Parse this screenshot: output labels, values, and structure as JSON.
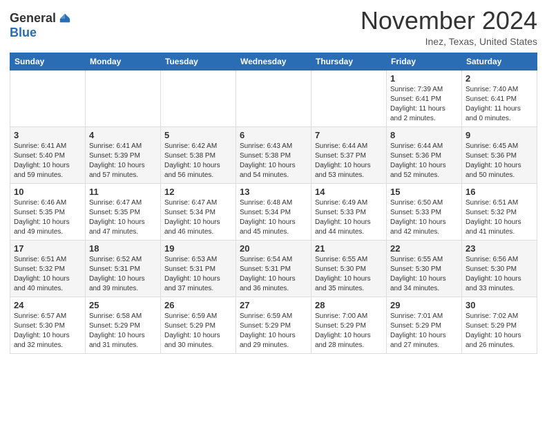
{
  "header": {
    "logo_general": "General",
    "logo_blue": "Blue",
    "month_title": "November 2024",
    "location": "Inez, Texas, United States"
  },
  "calendar": {
    "weekdays": [
      "Sunday",
      "Monday",
      "Tuesday",
      "Wednesday",
      "Thursday",
      "Friday",
      "Saturday"
    ],
    "weeks": [
      [
        {
          "day": "",
          "info": ""
        },
        {
          "day": "",
          "info": ""
        },
        {
          "day": "",
          "info": ""
        },
        {
          "day": "",
          "info": ""
        },
        {
          "day": "",
          "info": ""
        },
        {
          "day": "1",
          "info": "Sunrise: 7:39 AM\nSunset: 6:41 PM\nDaylight: 11 hours and 2 minutes."
        },
        {
          "day": "2",
          "info": "Sunrise: 7:40 AM\nSunset: 6:41 PM\nDaylight: 11 hours and 0 minutes."
        }
      ],
      [
        {
          "day": "3",
          "info": "Sunrise: 6:41 AM\nSunset: 5:40 PM\nDaylight: 10 hours and 59 minutes."
        },
        {
          "day": "4",
          "info": "Sunrise: 6:41 AM\nSunset: 5:39 PM\nDaylight: 10 hours and 57 minutes."
        },
        {
          "day": "5",
          "info": "Sunrise: 6:42 AM\nSunset: 5:38 PM\nDaylight: 10 hours and 56 minutes."
        },
        {
          "day": "6",
          "info": "Sunrise: 6:43 AM\nSunset: 5:38 PM\nDaylight: 10 hours and 54 minutes."
        },
        {
          "day": "7",
          "info": "Sunrise: 6:44 AM\nSunset: 5:37 PM\nDaylight: 10 hours and 53 minutes."
        },
        {
          "day": "8",
          "info": "Sunrise: 6:44 AM\nSunset: 5:36 PM\nDaylight: 10 hours and 52 minutes."
        },
        {
          "day": "9",
          "info": "Sunrise: 6:45 AM\nSunset: 5:36 PM\nDaylight: 10 hours and 50 minutes."
        }
      ],
      [
        {
          "day": "10",
          "info": "Sunrise: 6:46 AM\nSunset: 5:35 PM\nDaylight: 10 hours and 49 minutes."
        },
        {
          "day": "11",
          "info": "Sunrise: 6:47 AM\nSunset: 5:35 PM\nDaylight: 10 hours and 47 minutes."
        },
        {
          "day": "12",
          "info": "Sunrise: 6:47 AM\nSunset: 5:34 PM\nDaylight: 10 hours and 46 minutes."
        },
        {
          "day": "13",
          "info": "Sunrise: 6:48 AM\nSunset: 5:34 PM\nDaylight: 10 hours and 45 minutes."
        },
        {
          "day": "14",
          "info": "Sunrise: 6:49 AM\nSunset: 5:33 PM\nDaylight: 10 hours and 44 minutes."
        },
        {
          "day": "15",
          "info": "Sunrise: 6:50 AM\nSunset: 5:33 PM\nDaylight: 10 hours and 42 minutes."
        },
        {
          "day": "16",
          "info": "Sunrise: 6:51 AM\nSunset: 5:32 PM\nDaylight: 10 hours and 41 minutes."
        }
      ],
      [
        {
          "day": "17",
          "info": "Sunrise: 6:51 AM\nSunset: 5:32 PM\nDaylight: 10 hours and 40 minutes."
        },
        {
          "day": "18",
          "info": "Sunrise: 6:52 AM\nSunset: 5:31 PM\nDaylight: 10 hours and 39 minutes."
        },
        {
          "day": "19",
          "info": "Sunrise: 6:53 AM\nSunset: 5:31 PM\nDaylight: 10 hours and 37 minutes."
        },
        {
          "day": "20",
          "info": "Sunrise: 6:54 AM\nSunset: 5:31 PM\nDaylight: 10 hours and 36 minutes."
        },
        {
          "day": "21",
          "info": "Sunrise: 6:55 AM\nSunset: 5:30 PM\nDaylight: 10 hours and 35 minutes."
        },
        {
          "day": "22",
          "info": "Sunrise: 6:55 AM\nSunset: 5:30 PM\nDaylight: 10 hours and 34 minutes."
        },
        {
          "day": "23",
          "info": "Sunrise: 6:56 AM\nSunset: 5:30 PM\nDaylight: 10 hours and 33 minutes."
        }
      ],
      [
        {
          "day": "24",
          "info": "Sunrise: 6:57 AM\nSunset: 5:30 PM\nDaylight: 10 hours and 32 minutes."
        },
        {
          "day": "25",
          "info": "Sunrise: 6:58 AM\nSunset: 5:29 PM\nDaylight: 10 hours and 31 minutes."
        },
        {
          "day": "26",
          "info": "Sunrise: 6:59 AM\nSunset: 5:29 PM\nDaylight: 10 hours and 30 minutes."
        },
        {
          "day": "27",
          "info": "Sunrise: 6:59 AM\nSunset: 5:29 PM\nDaylight: 10 hours and 29 minutes."
        },
        {
          "day": "28",
          "info": "Sunrise: 7:00 AM\nSunset: 5:29 PM\nDaylight: 10 hours and 28 minutes."
        },
        {
          "day": "29",
          "info": "Sunrise: 7:01 AM\nSunset: 5:29 PM\nDaylight: 10 hours and 27 minutes."
        },
        {
          "day": "30",
          "info": "Sunrise: 7:02 AM\nSunset: 5:29 PM\nDaylight: 10 hours and 26 minutes."
        }
      ]
    ]
  }
}
